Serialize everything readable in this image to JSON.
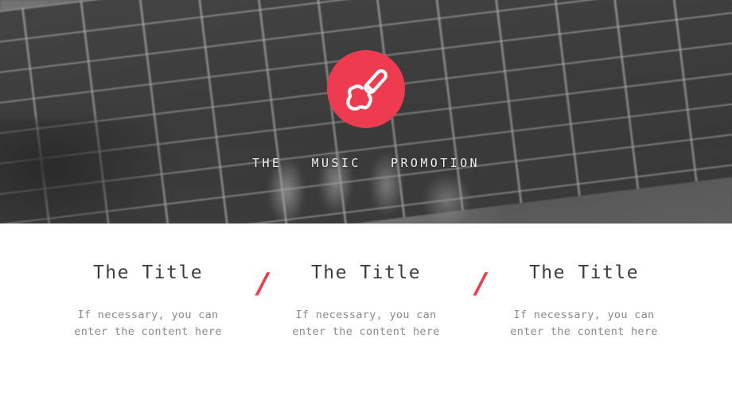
{
  "theme": {
    "accent_color": "#ee3b50",
    "title_color": "#3c3c3c",
    "body_color": "#8a8a8a",
    "tagline_color": "#f2f2f2",
    "page_background": "#ffffff"
  },
  "hero": {
    "badge": {
      "icon": "guitar-icon",
      "background_color": "#ee3b50",
      "icon_color": "#ffffff"
    },
    "tagline": "THE   MUSIC   PROMOTION",
    "image_description": "grayscale close-up photo of hands playing an acoustic guitar fretboard"
  },
  "features": {
    "divider_glyph": "/",
    "columns": [
      {
        "title": "The Title",
        "body": "If necessary, you can\nenter the content here"
      },
      {
        "title": "The Title",
        "body": "If necessary, you can\nenter the content here"
      },
      {
        "title": "The Title",
        "body": "If necessary, you can\nenter the content here"
      }
    ]
  }
}
